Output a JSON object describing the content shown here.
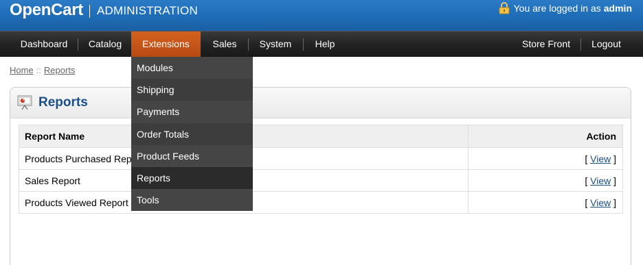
{
  "header": {
    "logo_name": "OpenCart",
    "logo_sub": "ADMINISTRATION",
    "login_text": "You are logged in as",
    "login_user": "admin",
    "lock_icon": "lock-icon"
  },
  "menu": {
    "dashboard": "Dashboard",
    "catalog": "Catalog",
    "extensions": "Extensions",
    "sales": "Sales",
    "system": "System",
    "help": "Help",
    "store_front": "Store Front",
    "logout": "Logout",
    "active_color": "#c8551a"
  },
  "dropdown": {
    "items": [
      {
        "label": "Modules"
      },
      {
        "label": "Shipping"
      },
      {
        "label": "Payments"
      },
      {
        "label": "Order Totals"
      },
      {
        "label": "Product Feeds"
      },
      {
        "label": "Reports"
      },
      {
        "label": "Tools"
      }
    ],
    "highlighted": "Reports"
  },
  "breadcrumb": {
    "home": "Home",
    "separator": "::",
    "current": "Reports"
  },
  "box": {
    "title": "Reports",
    "icon": "report-icon"
  },
  "table": {
    "headers": {
      "name": "Report Name",
      "action": "Action"
    },
    "rows": [
      {
        "name": "Products Purchased Report",
        "action_open": "[",
        "action_link": "View",
        "action_close": "]"
      },
      {
        "name": "Sales Report",
        "action_open": "[",
        "action_link": "View",
        "action_close": "]"
      },
      {
        "name": "Products Viewed Report",
        "action_open": "[",
        "action_link": "View",
        "action_close": "]"
      }
    ]
  }
}
